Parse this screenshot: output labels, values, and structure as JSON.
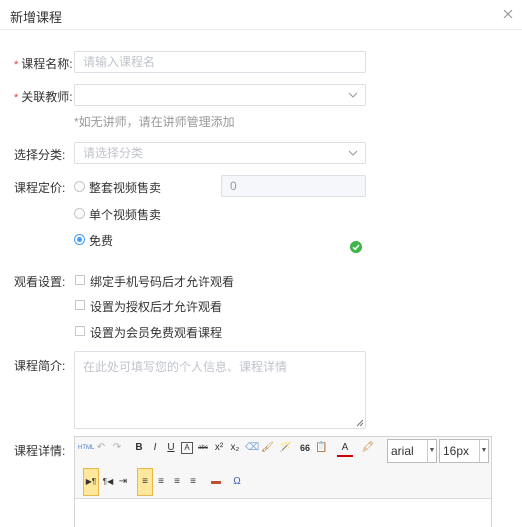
{
  "dialog": {
    "title": "新增课程"
  },
  "form": {
    "course_name": {
      "label": "课程名称:",
      "placeholder": "请输入课程名",
      "required": true
    },
    "teacher": {
      "label": "关联教师:",
      "value": "",
      "required": true,
      "hint": "*如无讲师，请在讲师管理添加"
    },
    "category": {
      "label": "选择分类:",
      "placeholder": "请选择分类"
    },
    "pricing": {
      "label": "课程定价:",
      "options": [
        {
          "label": "整套视频售卖",
          "checked": false
        },
        {
          "label": "单个视频售卖",
          "checked": false
        },
        {
          "label": "免费",
          "checked": true
        }
      ],
      "price_value": "0"
    },
    "viewing": {
      "label": "观看设置:",
      "options": [
        {
          "label": "绑定手机号码后才允许观看",
          "checked": false
        },
        {
          "label": "设置为授权后才允许观看",
          "checked": false
        },
        {
          "label": "设置为会员免费观看课程",
          "checked": false
        }
      ]
    },
    "intro": {
      "label": "课程简介:",
      "placeholder": "在此处可填写您的个人信息、课程详情"
    },
    "detail": {
      "label": "课程详情:",
      "font_family": "arial",
      "font_size": "16px",
      "toolbar_glyphs": {
        "html": "HTML",
        "undo": "↶",
        "redo": "↷",
        "bold": "B",
        "italic": "I",
        "underline": "U",
        "border": "A",
        "strike": "abc",
        "superscript": "x²",
        "subscript": "x₂",
        "eraser": "⌫",
        "brush": "🖌",
        "autotype": "🪄",
        "quote": "66",
        "paste": "📋",
        "font_color": "A",
        "bg_color": "🖍",
        "ltr": "▶¶",
        "rtl": "¶◀",
        "indent": "⇥",
        "align_left": "≡",
        "align_center": "≡",
        "align_right": "≡",
        "align_justify": "≡",
        "image": "▬",
        "special_char": "Ω"
      }
    }
  },
  "colors": {
    "accent": "#409eff",
    "required": "#e53935",
    "success": "#3eb449",
    "toolbar_active": "#ffe79c"
  }
}
